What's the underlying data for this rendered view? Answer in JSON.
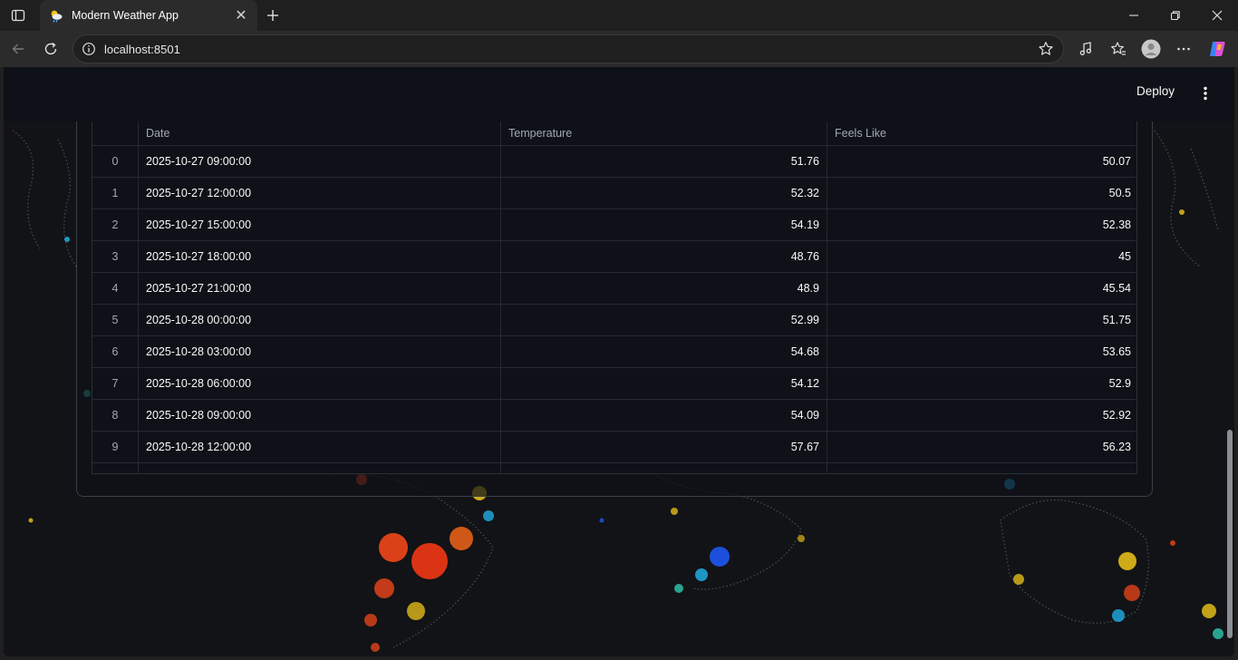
{
  "browser": {
    "tab_title": "Modern Weather App",
    "tab_close": "✕",
    "new_tab": "+",
    "url": "localhost:8501"
  },
  "app": {
    "deploy_label": "Deploy"
  },
  "table": {
    "columns": [
      "",
      "Date",
      "Temperature",
      "Feels Like"
    ],
    "rows": [
      {
        "index": "0",
        "date": "2025-10-27 09:00:00",
        "temperature": "51.76",
        "feels_like": "50.07"
      },
      {
        "index": "1",
        "date": "2025-10-27 12:00:00",
        "temperature": "52.32",
        "feels_like": "50.5"
      },
      {
        "index": "2",
        "date": "2025-10-27 15:00:00",
        "temperature": "54.19",
        "feels_like": "52.38"
      },
      {
        "index": "3",
        "date": "2025-10-27 18:00:00",
        "temperature": "48.76",
        "feels_like": "45"
      },
      {
        "index": "4",
        "date": "2025-10-27 21:00:00",
        "temperature": "48.9",
        "feels_like": "45.54"
      },
      {
        "index": "5",
        "date": "2025-10-28 00:00:00",
        "temperature": "52.99",
        "feels_like": "51.75"
      },
      {
        "index": "6",
        "date": "2025-10-28 03:00:00",
        "temperature": "54.68",
        "feels_like": "53.65"
      },
      {
        "index": "7",
        "date": "2025-10-28 06:00:00",
        "temperature": "54.12",
        "feels_like": "52.9"
      },
      {
        "index": "8",
        "date": "2025-10-28 09:00:00",
        "temperature": "54.09",
        "feels_like": "52.92"
      },
      {
        "index": "9",
        "date": "2025-10-28 12:00:00",
        "temperature": "57.67",
        "feels_like": "56.23"
      }
    ]
  },
  "colors": {
    "header_bg": "#0e1117",
    "map_bg": "#121316",
    "light_warm": "#ff4a1a",
    "light_yellow": "#ffd21a",
    "light_cool": "#22c3ff"
  }
}
